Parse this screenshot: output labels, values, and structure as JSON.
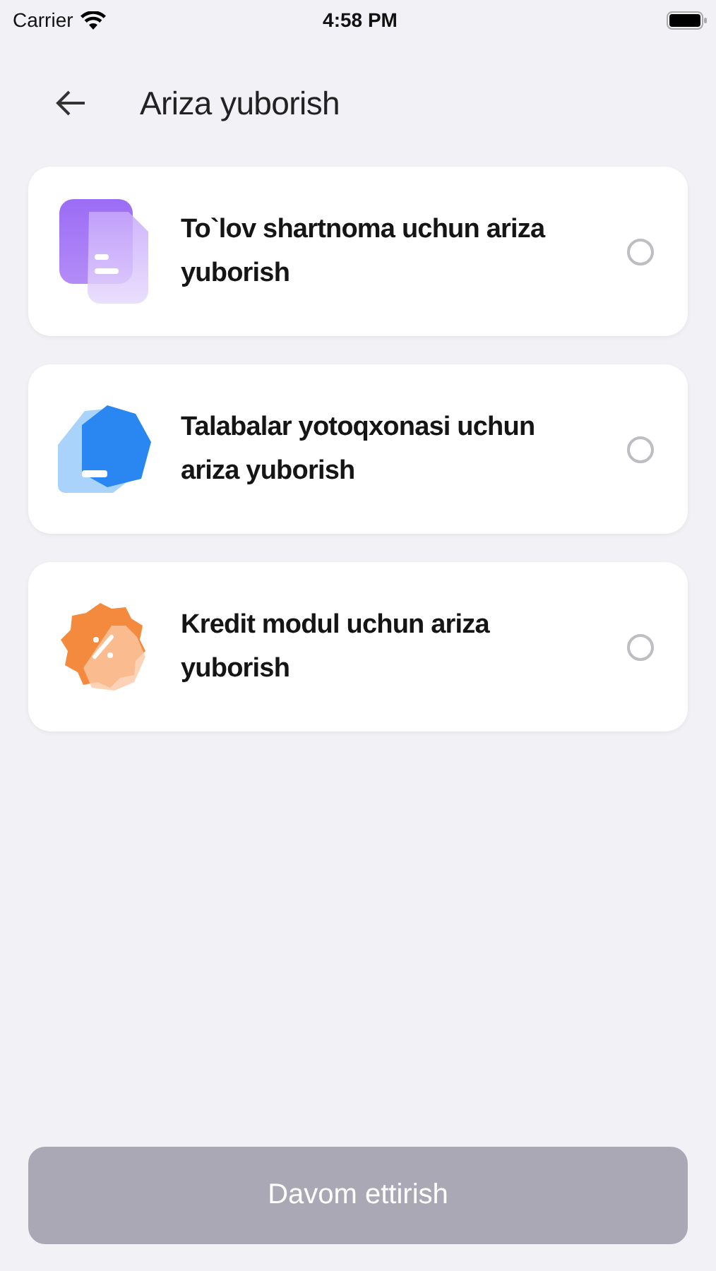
{
  "status_bar": {
    "carrier": "Carrier",
    "time": "4:58 PM"
  },
  "header": {
    "title": "Ariza yuborish"
  },
  "options": [
    {
      "kind": "document",
      "label": "To`lov shartnoma uchun ariza yuborish",
      "selected": false
    },
    {
      "kind": "house",
      "label": "Talabalar yotoqxonasi uchun ariza yuborish",
      "selected": false
    },
    {
      "kind": "discount",
      "label": "Kredit modul uchun ariza yuborish",
      "selected": false
    }
  ],
  "continue_button": {
    "label": "Davom ettirish",
    "disabled": true
  }
}
